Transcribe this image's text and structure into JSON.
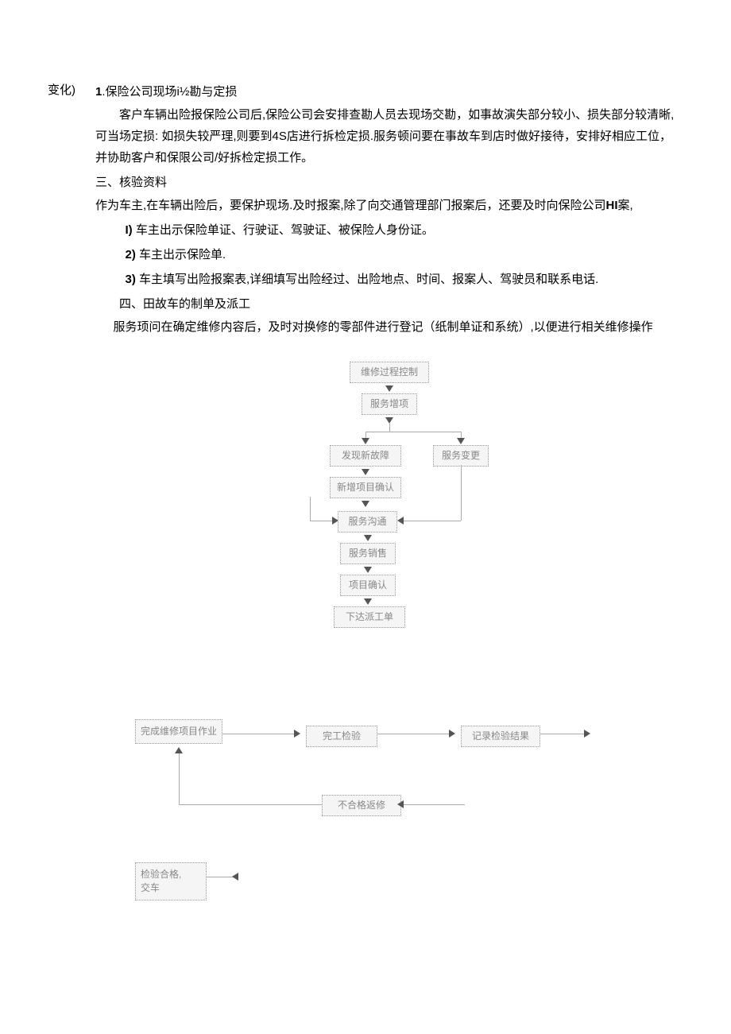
{
  "left_note": "变化)",
  "section1_num": "1",
  "section1_title": ".保险公司现场i½勘与定损",
  "section1_body": "客户车辆出险报保险公司后,保险公司会安排查勘人员去现场交勘，如事故演失部分较小、损失部分较清晰,可当场定损: 如损失较严理,则要到4S店进行拆检定损.服务顿问要在事故车到店时做好接待，安排好相应工位，并协助客户和保限公司/好拆检定损工作。",
  "section3_title": "三、核验资料",
  "section3_body": "作为车主,在车辆出险后，要保护现场.及时报案,除了向交通管理部门报案后，还要及时向保险公司HI案,",
  "item1_num": "I)",
  "item1_text": " 车主出示保险单证、行驶证、驾驶证、被保险人身份证。",
  "item2_num": "2)",
  "item2_text": " 车主出示保险单.",
  "item3_num": "3)",
  "item3_text": " 车主填写出险报案表,详细填写出险经过、出险地点、时间、报案人、驾驶员和联系电话.",
  "section4_title": "四、田故车的制单及派工",
  "section4_body": "服务顼问在确定维修内容后，及时对换修的零部件进行登记（纸制单证和系统）,以便进行相关维修操作",
  "flow1": {
    "box1": "维修过程控制",
    "box2": "服务增项",
    "box3": "发现新故障",
    "box4": "服务变更",
    "box5": "新增项目确认",
    "box6": "服务沟通",
    "box7": "服务销售",
    "box8": "项目确认",
    "box9": "下达派工单"
  },
  "flow2": {
    "box1": "完成维修项目作业",
    "box2": "完工检验",
    "box3": "记录检验结果",
    "box4": "不合格返修",
    "box5": "检验合格,\n交车"
  }
}
